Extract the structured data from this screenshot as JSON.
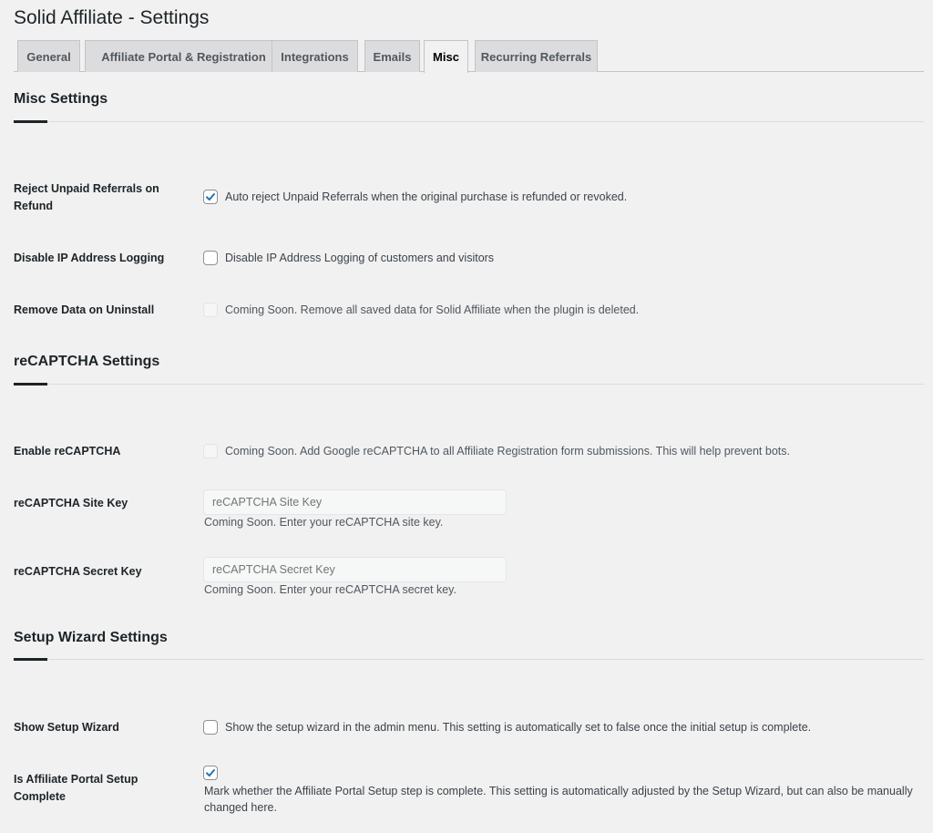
{
  "page": {
    "title": "Solid Affiliate - Settings"
  },
  "tabs": [
    {
      "label": "General",
      "active": false
    },
    {
      "label": "Affiliate Portal & Registration",
      "active": false
    },
    {
      "label": "Integrations",
      "active": false
    },
    {
      "label": "Emails",
      "active": false
    },
    {
      "label": "Misc",
      "active": true
    },
    {
      "label": "Recurring Referrals",
      "active": false
    }
  ],
  "misc": {
    "title": "Misc Settings",
    "reject_unpaid": {
      "label": "Reject Unpaid Referrals on Refund",
      "checked": true,
      "description": "Auto reject Unpaid Referrals when the original purchase is refunded or revoked."
    },
    "disable_ip": {
      "label": "Disable IP Address Logging",
      "checked": false,
      "description": "Disable IP Address Logging of customers and visitors"
    },
    "remove_data": {
      "label": "Remove Data on Uninstall",
      "checked": false,
      "disabled": true,
      "description": "Coming Soon. Remove all saved data for Solid Affiliate when the plugin is deleted."
    }
  },
  "recaptcha": {
    "title": "reCAPTCHA Settings",
    "enable": {
      "label": "Enable reCAPTCHA",
      "checked": false,
      "disabled": true,
      "description": "Coming Soon. Add Google reCAPTCHA to all Affiliate Registration form submissions. This will help prevent bots."
    },
    "site_key": {
      "label": "reCAPTCHA Site Key",
      "placeholder": "reCAPTCHA Site Key",
      "help": "Coming Soon. Enter your reCAPTCHA site key."
    },
    "secret_key": {
      "label": "reCAPTCHA Secret Key",
      "placeholder": "reCAPTCHA Secret Key",
      "help": "Coming Soon. Enter your reCAPTCHA secret key."
    }
  },
  "wizard": {
    "title": "Setup Wizard Settings",
    "show_wizard": {
      "label": "Show Setup Wizard",
      "checked": false,
      "description": "Show the setup wizard in the admin menu. This setting is automatically set to false once the initial setup is complete."
    },
    "portal_complete": {
      "label": "Is Affiliate Portal Setup Complete",
      "checked": true,
      "description": "Mark whether the Affiliate Portal Setup step is complete. This setting is automatically adjusted by the Setup Wizard, but can also be manually changed here."
    }
  },
  "colors": {
    "checkmark": "#2271b1",
    "text": "#1d2327",
    "muted": "#50575e",
    "background": "#f1f1f1"
  },
  "icons": {
    "checked": "checkmark-icon"
  }
}
